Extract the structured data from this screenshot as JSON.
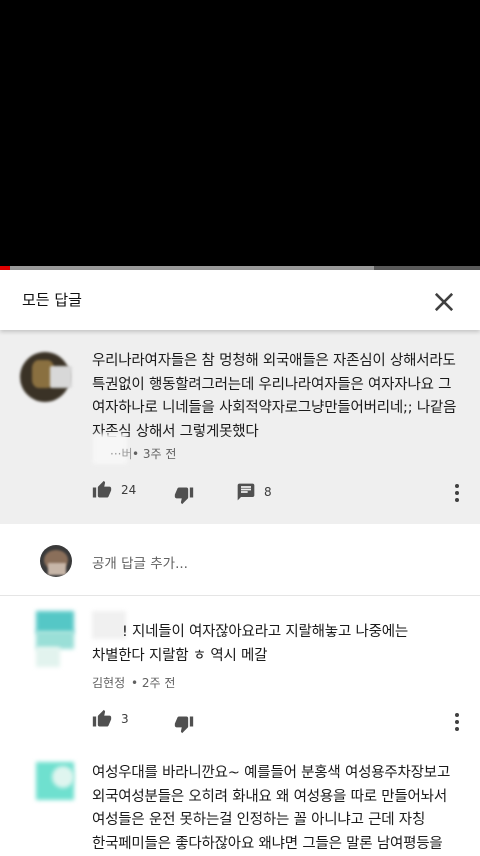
{
  "player": {
    "progress_fraction": 0.02,
    "buffered_fraction": 0.78
  },
  "panel": {
    "title": "모든 답글",
    "close_icon": "close-icon"
  },
  "parent_comment": {
    "lines": [
      "우리나라여자들은 참 멍청해 외국애들은 자존심이 상해서라도",
      "특권없이 행동할려그러는데 우리나라여자들은 여자자나요 그",
      "여자하나로 니네들을 사회적약자로그냥만들어버리네;; 나같음",
      "자존심 상해서 그렇게못했다"
    ],
    "author_fragment": "···버",
    "time": "• 3주 전",
    "likes": "24",
    "replies": "8"
  },
  "add_reply": {
    "placeholder": "공개 답글 추가..."
  },
  "replies": [
    {
      "lines": [
        "! 지네들이 여자잖아요라고 지랄해놓고 나중에는",
        "차별한다 지랄함 ㅎ 역시 메갈"
      ],
      "author": "김현정",
      "time": "• 2주 전",
      "likes": "3"
    },
    {
      "lines": [
        "여성우대를 바라니깐요~ 예를들어 분홍색 여성용주차장보고",
        "외국여성분들은 오히려 화내요 왜 여성용을 따로 만들어놔서",
        "여성들은 운전 못하는걸 인정하는 꼴 아니냐고 근데 자칭",
        "한국페미들은 좋다하잖아요 왜냐면 그들은 말론 남여평등을"
      ]
    }
  ],
  "colors": {
    "accent_red": "#e00000",
    "parent_bg": "#efefef",
    "avatar_teal": "#6fd6c8"
  }
}
